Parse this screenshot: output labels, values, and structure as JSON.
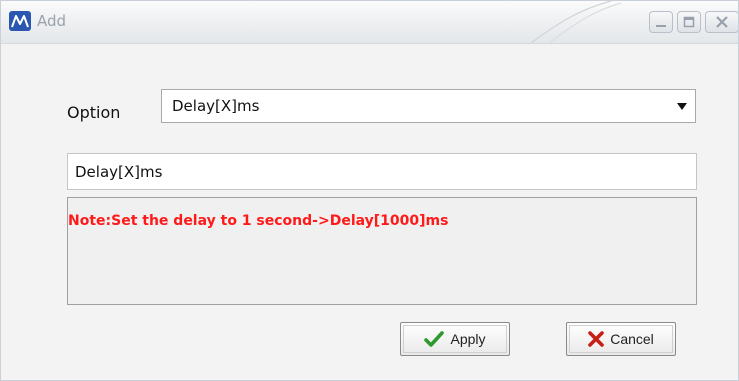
{
  "window": {
    "title": "Add",
    "app_icon": "app-logo-icon",
    "controls": [
      "minimize-icon",
      "maximize-icon",
      "close-icon"
    ]
  },
  "form": {
    "option_label": "Option",
    "option_selected": "Delay[X]ms",
    "input_value": "Delay[X]ms",
    "note": "Note:Set the delay to 1 second->Delay[1000]ms",
    "note_color": "#ff1a1a"
  },
  "buttons": {
    "apply_label": "Apply",
    "apply_icon": "checkmark-icon",
    "cancel_label": "Cancel",
    "cancel_icon": "x-icon"
  }
}
